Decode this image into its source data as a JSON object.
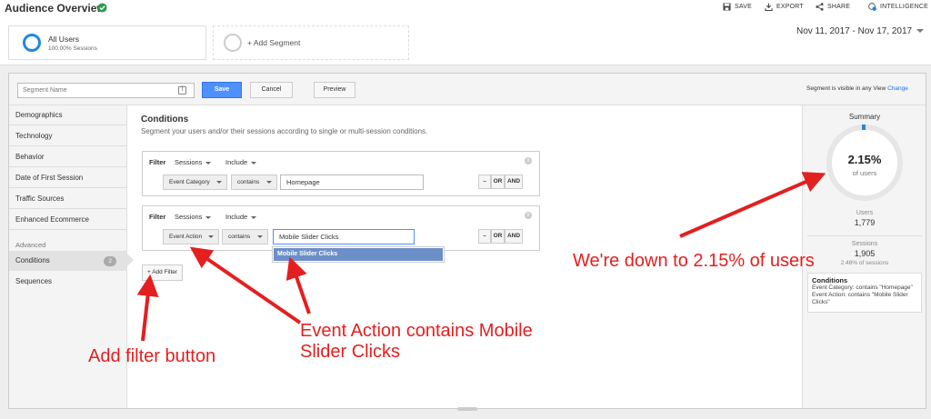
{
  "header": {
    "title": "Audience Overview",
    "actions": {
      "save": "SAVE",
      "export": "EXPORT",
      "share": "SHARE",
      "intelligence": "INTELLIGENCE"
    },
    "intelligence_badge": "4"
  },
  "segments": {
    "active": {
      "name": "All Users",
      "detail": "100.00% Sessions"
    },
    "add_label": "+ Add Segment"
  },
  "date_range": "Nov 11, 2017 - Nov 17, 2017",
  "builder": {
    "segment_name_placeholder": "Segment Name",
    "save_label": "Save",
    "cancel_label": "Cancel",
    "preview_label": "Preview",
    "visibility_text": "Segment is visible in any View",
    "change_link": "Change"
  },
  "nav": {
    "items": [
      "Demographics",
      "Technology",
      "Behavior",
      "Date of First Session",
      "Traffic Sources",
      "Enhanced Ecommerce"
    ],
    "group_label": "Advanced",
    "advanced_items": [
      {
        "label": "Conditions",
        "badge": "2"
      },
      {
        "label": "Sequences"
      }
    ]
  },
  "conditions": {
    "title": "Conditions",
    "description": "Segment your users and/or their sessions according to single or multi-session conditions.",
    "filters": [
      {
        "label": "Filter",
        "scope": "Sessions",
        "mode": "Include",
        "dimension": "Event Category",
        "operator": "contains",
        "value": "Homepage"
      },
      {
        "label": "Filter",
        "scope": "Sessions",
        "mode": "Include",
        "dimension": "Event Action",
        "operator": "contains",
        "value": "Mobile Slider Clicks"
      }
    ],
    "remove_label": "–",
    "or_label": "OR",
    "and_label": "AND",
    "close_label": "x",
    "suggestion": "Mobile Slider Clicks",
    "add_filter_label": "+ Add Filter"
  },
  "summary": {
    "title": "Summary",
    "percent": "2.15%",
    "percent_label": "of users",
    "users_label": "Users",
    "users_value": "1,779",
    "sessions_label": "Sessions",
    "sessions_value": "1,905",
    "sessions_sub": "2.48% of sessions",
    "conditions_heading": "Conditions",
    "conditions_lines": [
      "Event Category: contains \"Homepage\"",
      "Event Action: contains \"Mobile Slider Clicks\""
    ]
  },
  "annotations": {
    "users_note": "We're down to 2.15% of users",
    "event_action_note_1": "Event Action contains Mobile",
    "event_action_note_2": "Slider Clicks",
    "add_filter_note": "Add filter button"
  },
  "colors": {
    "accent_blue": "#4d90fe",
    "annotation_red": "#e41f1f",
    "suggestion_bg": "#6d8fc9"
  }
}
